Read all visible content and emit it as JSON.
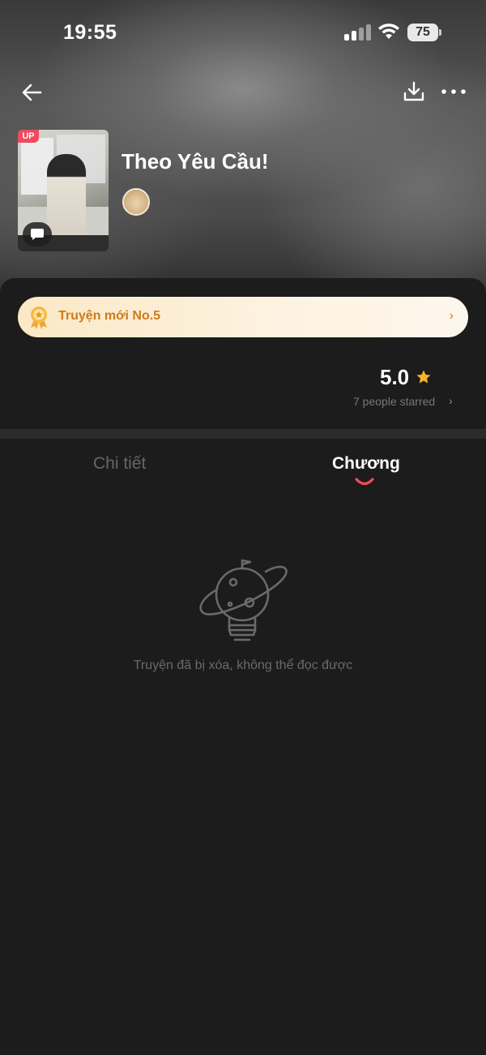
{
  "status_bar": {
    "time": "19:55",
    "battery": "75"
  },
  "book": {
    "title": "Theo Yêu Cầu!",
    "cover_badge": "UP"
  },
  "rank_banner": {
    "label": "Truyện mới No.5",
    "chevron": "›"
  },
  "rating": {
    "value": "5.0",
    "count_text": "7 people starred",
    "chevron": "›"
  },
  "tabs": [
    {
      "label": "Chi tiết",
      "active": false
    },
    {
      "label": "Chương",
      "active": true
    }
  ],
  "empty_state": {
    "message": "Truyện đã bị xóa, không thể đọc được"
  },
  "colors": {
    "accent": "#f04a5c",
    "banner_text": "#d07a17",
    "star": "#f5b52b",
    "background": "#1c1c1c"
  },
  "icons": [
    "back-arrow-icon",
    "download-icon",
    "more-icon",
    "comment-icon",
    "medal-icon",
    "star-icon",
    "planet-bulb-icon"
  ]
}
